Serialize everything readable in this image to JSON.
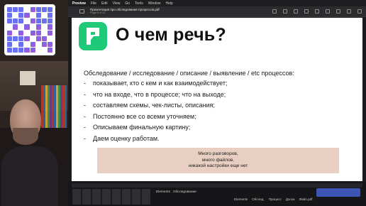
{
  "menubar": {
    "app_name": "Preview",
    "items": [
      "File",
      "Edit",
      "View",
      "Go",
      "Tools",
      "Window",
      "Help"
    ]
  },
  "window": {
    "doc_title": "Презентация про обследование процессов.pdf",
    "doc_subtitle": "Page 5 of 12"
  },
  "slide": {
    "heading": "О чем речь?",
    "intro": "Обследование / исследование / описание / выявление / etc процессов:",
    "bullets": [
      "показывает, кто с кем и как взаимодействует;",
      "что на входе, что в процессе; что на выходе;",
      "составляем схемы, чек-листы, описания;",
      "Постоянно все со всеми уточняем;",
      "Описываем финальную картину;",
      "Даем оценку работам."
    ],
    "bullet_marker": "-",
    "callout_lines": [
      "Много разговоров,",
      "много файлов,",
      "никакой настройки еще нет"
    ],
    "logo_color": "#20c978",
    "callout_color": "#e8cfc1"
  },
  "taskbar": {
    "tabs": [
      "Elements",
      "Обследование"
    ],
    "right_items": [
      "Elements",
      "Обслед.",
      "Процесс",
      "Доска",
      "Файл.pdf"
    ]
  }
}
